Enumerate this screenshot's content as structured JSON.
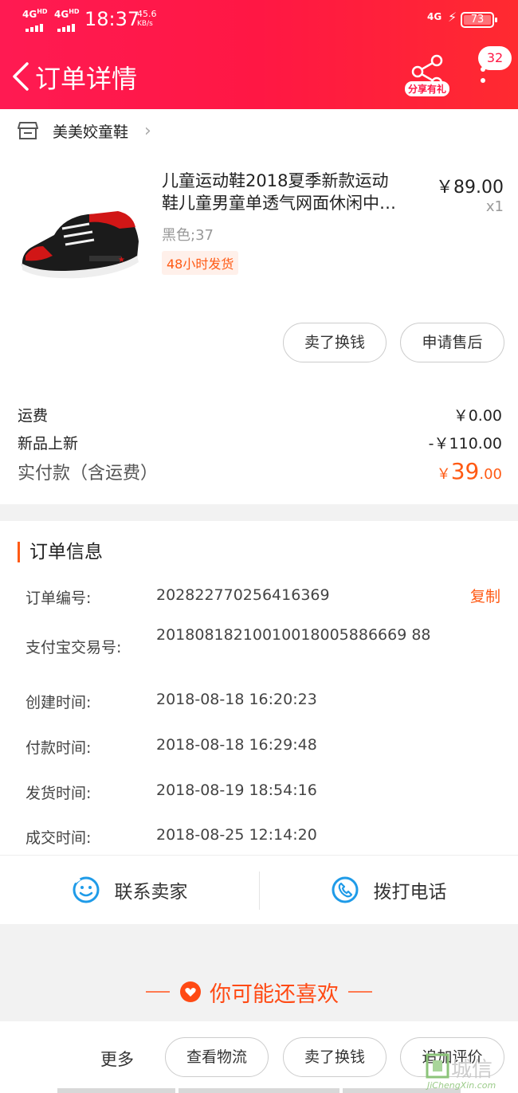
{
  "status_bar": {
    "net1": "4G",
    "net1_sup": "HD",
    "net2": "4G",
    "net2_sup": "HD",
    "time": "18:37",
    "speed_value": "45.6",
    "speed_unit": "KB/s",
    "net_right": "4G",
    "battery": "73"
  },
  "header": {
    "title": "订单详情",
    "share_label": "分享有礼",
    "message_count": "32"
  },
  "shop": {
    "name": "美美姣童鞋"
  },
  "product": {
    "name_line1": "儿童运动鞋2018夏季新款运动",
    "name_line2": "鞋儿童男童单透气网面休闲中…",
    "price": "￥89.00",
    "quantity": "x1",
    "sku": "黑色;37",
    "ship_tag": "48小时发货",
    "buttons": {
      "resell": "卖了换钱",
      "after_sale": "申请售后"
    }
  },
  "fees": [
    {
      "label": "运费",
      "value": "￥0.00"
    },
    {
      "label": "新品上新",
      "value": "-￥110.00"
    }
  ],
  "paid": {
    "label": "实付款（含运费）",
    "currency": "￥",
    "integer": "39",
    "decimal": ".00"
  },
  "order_info": {
    "title": "订单信息",
    "copy_label": "复制",
    "rows": [
      {
        "key": "订单编号:",
        "value": "202822770256416369"
      },
      {
        "key": "支付宝交易号:",
        "value": "20180818210010018005886669 88"
      },
      {
        "key": "创建时间:",
        "value": "2018-08-18 16:20:23"
      },
      {
        "key": "付款时间:",
        "value": "2018-08-18 16:29:48"
      },
      {
        "key": "发货时间:",
        "value": "2018-08-19 18:54:16"
      },
      {
        "key": "成交时间:",
        "value": "2018-08-25 12:14:20"
      }
    ]
  },
  "contact": {
    "seller": "联系卖家",
    "phone": "拨打电话"
  },
  "recommend": {
    "title": "你可能还喜欢"
  },
  "bottom_bar": {
    "more": "更多",
    "logistics": "查看物流",
    "resell": "卖了换钱",
    "review": "追加评价"
  },
  "watermark": {
    "text": "城信",
    "sub": "JiChengXin.com"
  },
  "colors": {
    "header": "#ff1744",
    "accent": "#ff5a14",
    "icon_blue": "#1f9be8"
  }
}
